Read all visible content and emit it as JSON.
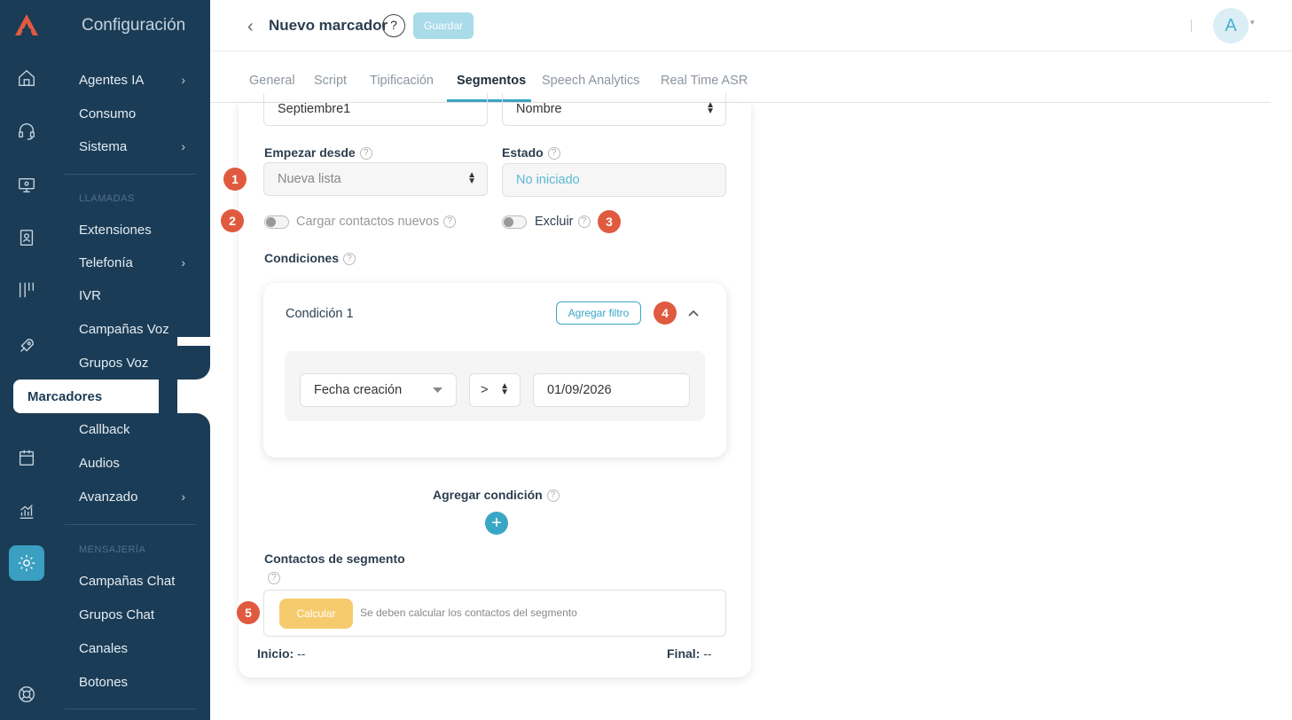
{
  "sidebar": {
    "section_title": "Configuración",
    "items": [
      {
        "label": "Agentes IA",
        "chevron": true
      },
      {
        "label": "Consumo",
        "chevron": false
      },
      {
        "label": "Sistema",
        "chevron": true
      }
    ],
    "llamadas_heading": "LLAMADAS",
    "llamadas_items": [
      {
        "label": "Extensiones",
        "chevron": false
      },
      {
        "label": "Telefonía",
        "chevron": true
      },
      {
        "label": "IVR",
        "chevron": false
      },
      {
        "label": "Campañas Voz",
        "chevron": false
      },
      {
        "label": "Grupos Voz",
        "chevron": false
      },
      {
        "label": "Marcadores",
        "active": true
      },
      {
        "label": "Callback",
        "chevron": false
      },
      {
        "label": "Audios",
        "chevron": false
      },
      {
        "label": "Avanzado",
        "chevron": true
      }
    ],
    "mensajeria_heading": "MENSAJERÍA",
    "mensajeria_items": [
      {
        "label": "Campañas Chat"
      },
      {
        "label": "Grupos Chat"
      },
      {
        "label": "Canales"
      },
      {
        "label": "Botones"
      }
    ],
    "chevron_glyph": "›"
  },
  "header": {
    "back_glyph": "‹",
    "title": "Nuevo marcador",
    "help_glyph": "?",
    "save_label": "Guardar",
    "avatar_initial": "A",
    "caret_glyph": "▾"
  },
  "tabs": [
    {
      "label": "General"
    },
    {
      "label": "Script"
    },
    {
      "label": "Tipificación"
    },
    {
      "label": "Segmentos",
      "active": true
    },
    {
      "label": "Speech Analytics"
    },
    {
      "label": "Real Time ASR"
    }
  ],
  "form": {
    "name_value": "Septiembre1",
    "sort_value": "Nombre",
    "start_label": "Empezar desde",
    "start_value": "Nueva lista",
    "state_label": "Estado",
    "state_value": "No iniciado",
    "load_new_label": "Cargar contactos nuevos",
    "exclude_label": "Excluir",
    "conditions_label": "Condiciones",
    "condition_title": "Condición 1",
    "add_filter_label": "Agregar filtro",
    "filter_field": "Fecha creación",
    "filter_operator": ">",
    "filter_value": "01/09/2026",
    "add_condition_label": "Agregar condición",
    "segment_contacts_label": "Contactos de segmento",
    "calc_label": "Calcular",
    "calc_hint": "Se deben calcular los contactos del segmento",
    "start_prefix": "Inicio:",
    "start_range": "--",
    "end_prefix": "Final:",
    "end_range": "--",
    "help_glyph": "?"
  },
  "markers": [
    "1",
    "2",
    "3",
    "4",
    "5"
  ],
  "colors": {
    "sidebar": "#1b3c56",
    "accent": "#3aa6c6",
    "marker": "#e05a3f",
    "calc_button": "#f6cb6d"
  }
}
